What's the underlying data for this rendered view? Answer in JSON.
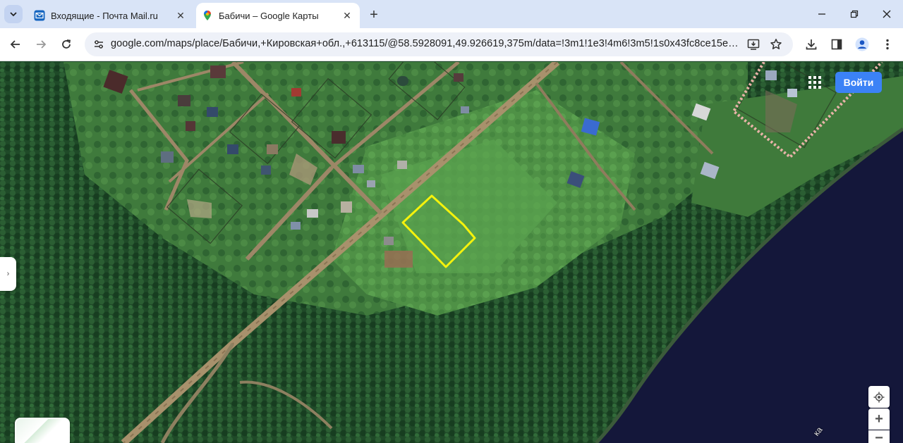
{
  "browser": {
    "tabs": [
      {
        "title": "Входящие - Почта Mail.ru",
        "favicon": "mail-envelope-icon",
        "active": false
      },
      {
        "title": "Бабичи – Google Карты",
        "favicon": "google-maps-pin-icon",
        "active": true
      }
    ],
    "new_tab_label": "+",
    "url": "google.com/maps/place/Бабичи,+Кировская+обл.,+613115/@58.5928091,49.926619,375m/data=!3m1!1e3!4m6!3m5!1s0x43fc8ce15e75fa05:..."
  },
  "map": {
    "signin_label": "Войти",
    "river_label_fragment": "ка",
    "zoom_in_label": "+",
    "zoom_out_label": "−",
    "side_panel_toggle": "›",
    "view_type": "satellite",
    "highlight_color": "#f5f20c",
    "parcel_boundary_color": "#e8b3a8"
  },
  "icons": {
    "tab_list": "chevron-down-icon",
    "back": "arrow-left-icon",
    "forward": "arrow-right-icon",
    "reload": "reload-icon",
    "site_info": "tune-icon",
    "install": "install-app-icon",
    "bookmark": "star-icon",
    "downloads": "download-icon",
    "side_panel": "side-panel-icon",
    "profile": "profile-icon",
    "menu": "kebab-menu-icon",
    "apps": "apps-grid-icon",
    "my_location": "my-location-icon"
  }
}
